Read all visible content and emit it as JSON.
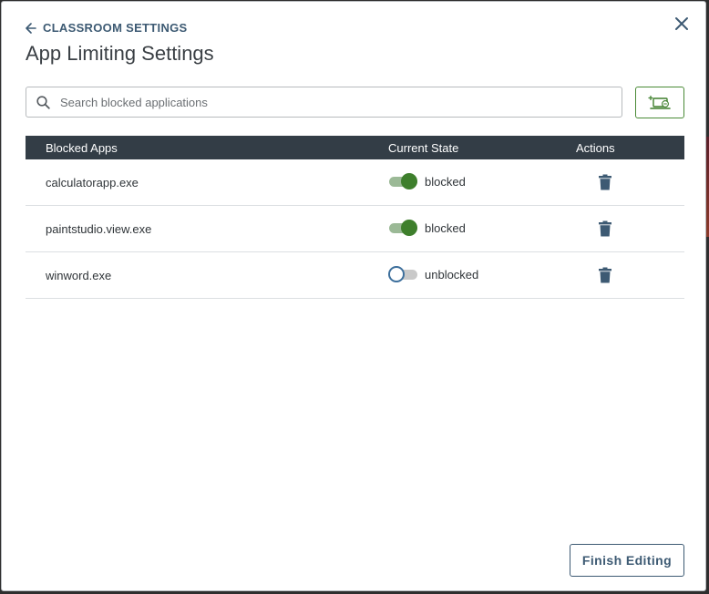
{
  "header": {
    "back_label": "CLASSROOM SETTINGS",
    "title": "App Limiting Settings"
  },
  "search": {
    "placeholder": "Search blocked applications",
    "value": ""
  },
  "table": {
    "columns": {
      "app": "Blocked Apps",
      "state": "Current State",
      "actions": "Actions"
    },
    "rows": [
      {
        "app": "calculatorapp.exe",
        "state": "blocked",
        "enabled": true
      },
      {
        "app": "paintstudio.view.exe",
        "state": "blocked",
        "enabled": true
      },
      {
        "app": "winword.exe",
        "state": "unblocked",
        "enabled": false
      }
    ]
  },
  "footer": {
    "finish_label": "Finish Editing"
  },
  "icons": {
    "back": "arrow-left-icon",
    "close": "close-icon",
    "search": "search-icon",
    "add_app": "add-laptop-icon",
    "delete": "trash-icon"
  },
  "colors": {
    "header_bg": "#333d46",
    "accent_blue": "#3d5a73",
    "toggle_on": "#3e7f2c",
    "add_button_border": "#4a8a36"
  }
}
